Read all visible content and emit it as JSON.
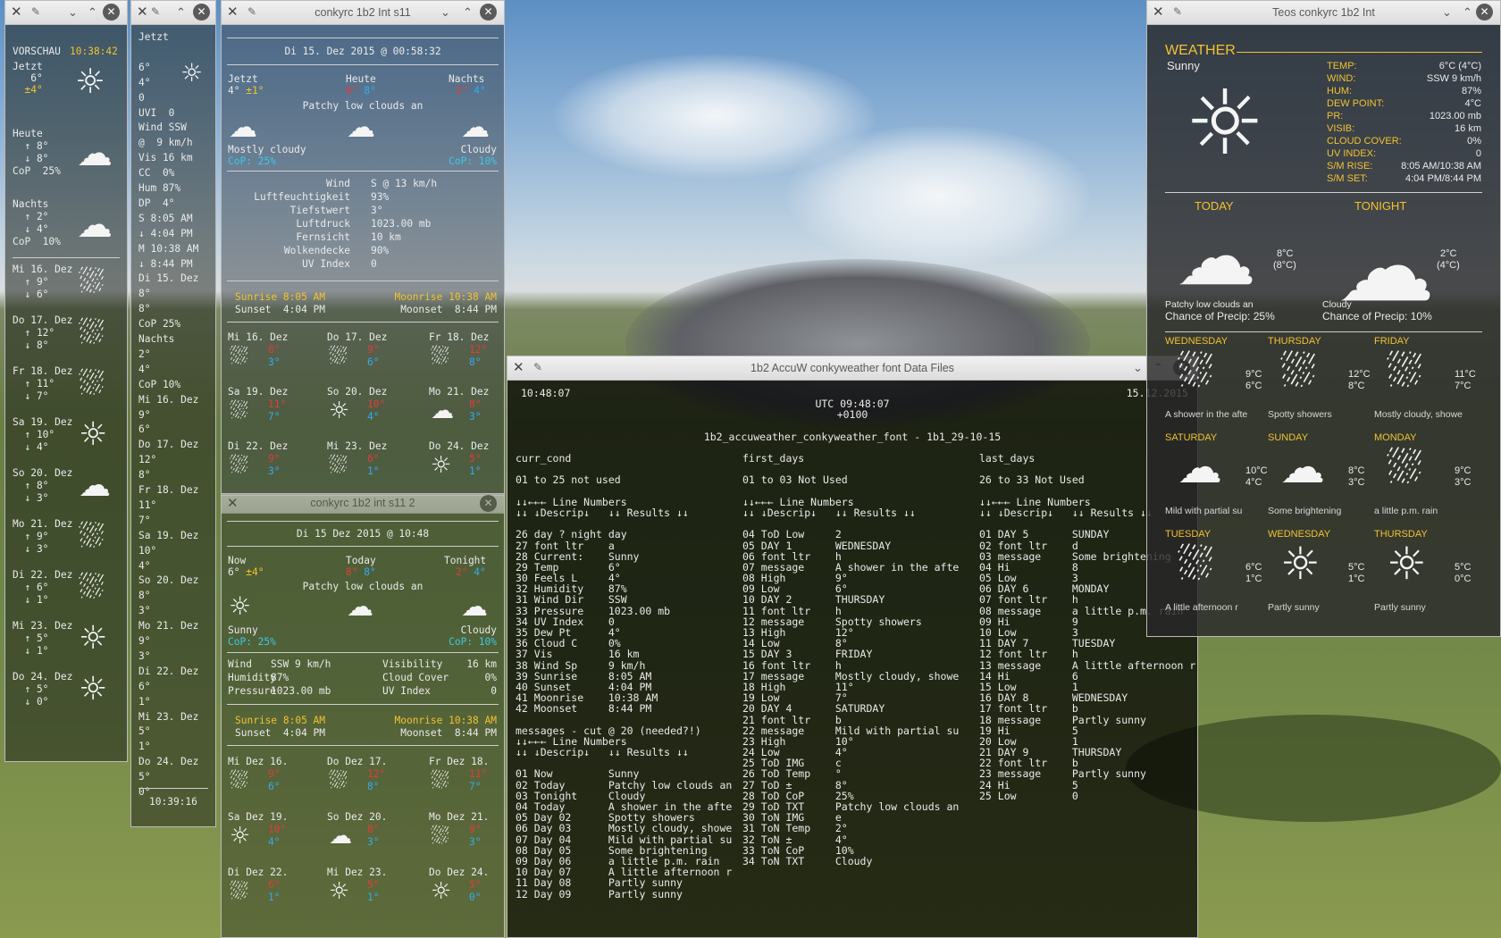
{
  "win_a": {
    "hdr": [
      "VORSCHAU",
      "10:38:42"
    ],
    "now": [
      "Jetzt",
      "   6°",
      "  ±4°"
    ],
    "today": [
      "Heute",
      "  ↑ 8°",
      "  ↓ 8°",
      "CoP  25%"
    ],
    "night": [
      "Nachts",
      "  ↑ 2°",
      "  ↓ 4°",
      "CoP  10%"
    ],
    "days": [
      {
        "n": "Mi 16. Dez",
        "h": "  ↑ 9°",
        "l": "  ↓ 6°"
      },
      {
        "n": "Do 17. Dez",
        "h": "  ↑ 12°",
        "l": "  ↓ 8°"
      },
      {
        "n": "Fr 18. Dez",
        "h": "  ↑ 11°",
        "l": "  ↓ 7°"
      },
      {
        "n": "Sa 19. Dez",
        "h": "  ↑ 10°",
        "l": "  ↓ 4°"
      },
      {
        "n": "So 20. Dez",
        "h": "  ↑ 8°",
        "l": "  ↓ 3°"
      },
      {
        "n": "Mo 21. Dez",
        "h": "  ↑ 9°",
        "l": "  ↓ 3°"
      },
      {
        "n": "Di 22. Dez",
        "h": "  ↑ 6°",
        "l": "  ↓ 1°"
      },
      {
        "n": "Mi 23. Dez",
        "h": "  ↑ 5°",
        "l": "  ↓ 1°"
      },
      {
        "n": "Do 24. Dez",
        "h": "  ↑ 5°",
        "l": "  ↓ 0°"
      }
    ]
  },
  "win_b": {
    "lines": [
      "Jetzt",
      "",
      "6°",
      "4°",
      "0",
      "UVI  0",
      "Wind SSW",
      "@  9 km/h",
      "Vis 16 km",
      "CC  0%",
      "Hum 87%",
      "DP  4°",
      "S 8:05 AM",
      "↓ 4:04 PM",
      "M 10:38 AM",
      "↓ 8:44 PM",
      "Di 15. Dez",
      "8°",
      "8°",
      "CoP 25%",
      "Nachts",
      "2°",
      "4°",
      "CoP 10%",
      "Mi 16. Dez",
      "9°",
      "6°",
      "Do 17. Dez",
      "12°",
      "8°",
      "Fr 18. Dez",
      "11°",
      "7°",
      "Sa 19. Dez",
      "10°",
      "4°",
      "So 20. Dez",
      "8°",
      "3°",
      "Mo 21. Dez",
      "9°",
      "3°",
      "Di 22. Dez",
      "6°",
      "1°",
      "Mi 23. Dez",
      "5°",
      "1°",
      "Do 24. Dez",
      "5°",
      "0°"
    ],
    "clock": "10:39:16"
  },
  "win_c": {
    "title": "conkyrc 1b2 Int s11",
    "date": "Di 15. Dez 2015 @ 00:58:32",
    "cols": [
      "Jetzt",
      "Heute",
      "Nachts"
    ],
    "now_t": "4°",
    "now_f": "±1°",
    "today_h": "8°",
    "today_l": "8°",
    "night_h": "3°",
    "night_l": "4°",
    "desc": "Patchy low clouds an",
    "left_desc": "Mostly cloudy",
    "left_cop": "CoP: 25%",
    "right_desc": "Cloudy",
    "right_cop": "CoP: 10%",
    "details": [
      [
        "Wind",
        "S @ 13 km/h"
      ],
      [
        "Luftfeuchtigkeit",
        "93%"
      ],
      [
        "Tiefstwert",
        "3°"
      ],
      [
        "Luftdruck",
        "1023.00 mb"
      ],
      [
        "Fernsicht",
        "10 km"
      ],
      [
        "Wolkendecke",
        "90%"
      ],
      [
        "UV Index",
        "0"
      ]
    ],
    "sunrise": "Sunrise 8:05 AM",
    "sunset": "Sunset  4:04 PM",
    "moonrise": "Moonrise 10:38 AM",
    "moonset": "Moonset  8:44 PM",
    "days": [
      {
        "n": "Mi 16. Dez",
        "h": "8°",
        "l": "3°"
      },
      {
        "n": "Do 17. Dez",
        "h": "9°",
        "l": "6°"
      },
      {
        "n": "Fr 18. Dez",
        "h": "12°",
        "l": "8°"
      },
      {
        "n": "Sa 19. Dez",
        "h": "11°",
        "l": "7°"
      },
      {
        "n": "So 20. Dez",
        "h": "10°",
        "l": "4°"
      },
      {
        "n": "Mo 21. Dez",
        "h": "8°",
        "l": "3°"
      },
      {
        "n": "Di 22. Dez",
        "h": "9°",
        "l": "3°"
      },
      {
        "n": "Mi 23. Dez",
        "h": "6°",
        "l": "1°"
      },
      {
        "n": "Do 24. Dez",
        "h": "5°",
        "l": "1°"
      }
    ]
  },
  "win_d": {
    "title": "conkyrc 1b2 int s11 2",
    "date": "Di 15 Dez 2015 @ 10:48",
    "cols": [
      "Now",
      "Today",
      "Tonight"
    ],
    "now_t": "6°",
    "now_f": "±4°",
    "today_h": "8°",
    "today_l": "8°",
    "night_h": "2°",
    "night_l": "4°",
    "desc": "Patchy low clouds an",
    "left_desc": "Sunny",
    "left_cop": "CoP: 25%",
    "right_desc": "Cloudy",
    "right_cop": "CoP: 10%",
    "details": [
      [
        "Wind",
        "SSW 9 km/h",
        "Visibility",
        "16 km"
      ],
      [
        "Humidity",
        "87%",
        "Cloud Cover",
        "0%"
      ],
      [
        "Pressure",
        "1023.00 mb",
        "UV Index",
        "0"
      ]
    ],
    "sunrise": "Sunrise 8:05 AM",
    "sunset": "Sunset  4:04 PM",
    "moonrise": "Moonrise 10:38 AM",
    "moonset": "Moonset  8:44 PM",
    "days": [
      {
        "n": "Mi Dez 16.",
        "h": "9°",
        "l": "6°"
      },
      {
        "n": "Do Dez 17.",
        "h": "12°",
        "l": "8°"
      },
      {
        "n": "Fr Dez 18.",
        "h": "11°",
        "l": "7°"
      },
      {
        "n": "Sa Dez 19.",
        "h": "10°",
        "l": "4°"
      },
      {
        "n": "So Dez 20.",
        "h": "8°",
        "l": "3°"
      },
      {
        "n": "Mo Dez 21.",
        "h": "9°",
        "l": "3°"
      },
      {
        "n": "Di Dez 22.",
        "h": "6°",
        "l": "1°"
      },
      {
        "n": "Mi Dez 23.",
        "h": "5°",
        "l": "1°"
      },
      {
        "n": "Do Dez 24.",
        "h": "5°",
        "l": "0°"
      }
    ]
  },
  "win_e": {
    "title": "1b2 AccuW conkyweather font Data Files",
    "time": "10:48:07",
    "date": "15.12.2015",
    "utc": "UTC 09:48:07",
    "tz": "+0100",
    "file": "1b2_accuweather_conkyweather_font - 1b1_29-10-15",
    "col1": "curr_cond\n\n01 to 25 not used\n\n↓↓←←← Line Numbers\n↓↓ ↓Descrip↓   ↓↓ Results ↓↓\n\n26 day ? night day\n27 font ltr    a\n28 Current:    Sunny\n29 Temp        6°\n30 Feels L     4°\n32 Humidity    87%\n31 Wind Dir    SSW\n33 Pressure    1023.00 mb\n34 UV Index    0\n35 Dew Pt      4°\n36 Cloud C     0%\n37 Vis         16 km\n38 Wind Sp     9 km/h\n39 Sunrise     8:05 AM\n40 Sunset      4:04 PM\n41 Moonrise    10:38 AM\n42 Moonset     8:44 PM\n\nmessages - cut @ 20 (needed?!)\n↓↓←←← Line Numbers\n↓↓ ↓Descrip↓   ↓↓ Results ↓↓\n\n01 Now         Sunny\n02 Today       Patchy low clouds an\n03 Tonight     Cloudy\n04 Today       A shower in the afte\n05 Day 02      Spotty showers\n06 Day 03      Mostly cloudy, showe\n07 Day 04      Mild with partial su\n08 Day 05      Some brightening\n09 Day 06      a little p.m. rain\n10 Day 07      A little afternoon r\n11 Day 08      Partly sunny\n12 Day 09      Partly sunny",
    "col2": "first_days\n\n01 to 03 Not Used\n\n↓↓←←← Line Numbers\n↓↓ ↓Descrip↓   ↓↓ Results ↓↓\n\n04 ToD Low     2\n05 DAY 1       WEDNESDAY\n06 font ltr    h\n07 message     A shower in the afte\n08 High        9°\n09 Low         6°\n10 DAY 2       THURSDAY\n11 font ltr    h\n12 message     Spotty showers\n13 High        12°\n14 Low         8°\n15 DAY 3       FRIDAY\n16 font ltr    h\n17 message     Mostly cloudy, showe\n18 High        11°\n19 Low         7°\n20 DAY 4       SATURDAY\n21 font ltr    b\n22 message     Mild with partial su\n23 High        10°\n24 Low         4°\n25 ToD IMG     c\n26 ToD Temp    °\n27 ToD ±       8°\n28 ToD CoP     25%\n29 ToD TXT     Patchy low clouds an\n30 ToN IMG     e\n31 ToN Temp    2°\n32 ToN ±       4°\n33 ToN CoP     10%\n34 ToN TXT     Cloudy",
    "col3": "last_days\n\n26 to 33 Not Used\n\n↓↓←←← Line Numbers\n↓↓ ↓Descrip↓   ↓↓ Results ↓↓\n\n01 DAY 5       SUNDAY\n02 font ltr    d\n03 message     Some brightening\n04 Hi          8\n05 Low         3\n06 DAY 6       MONDAY\n07 font ltr    h\n08 message     a little p.m. rain\n09 Hi          9\n10 Low         3\n11 DAY 7       TUESDAY\n12 font ltr    h\n13 message     A little afternoon r\n14 Hi          6\n15 Low         1\n16 DAY 8       WEDNESDAY\n17 font ltr    b\n18 message     Partly sunny\n19 Hi          5\n20 Low         1\n21 DAY 9       THURSDAY\n22 font ltr    b\n23 message     Partly sunny\n24 Hi          5\n25 Low         0"
  },
  "win_f": {
    "title": "Teos conkyrc 1b2 Int",
    "heading": "WEATHER",
    "cond": "Sunny",
    "stats": [
      [
        "TEMP:",
        "6°C (4°C)"
      ],
      [
        "WIND:",
        "SSW 9 km/h"
      ],
      [
        "HUM:",
        "87%"
      ],
      [
        "DEW POINT:",
        "4°C"
      ],
      [
        "PR:",
        "1023.00 mb"
      ],
      [
        "VISIB:",
        "16 km"
      ],
      [
        "CLOUD COVER:",
        "0%"
      ],
      [
        "UV INDEX:",
        "0"
      ],
      [
        "S/M RISE:",
        "8:05 AM/10:38 AM"
      ],
      [
        "S/M SET:",
        "4:04 PM/8:44 PM"
      ]
    ],
    "today": {
      "label": "TODAY",
      "temp": "8°C",
      "feel": "(8°C)",
      "desc": "Patchy low clouds an",
      "cop": "Chance of Precip: 25%"
    },
    "tonight": {
      "label": "TONIGHT",
      "temp": "2°C",
      "feel": "(4°C)",
      "desc": "Cloudy",
      "cop": "Chance of Precip: 10%"
    },
    "days": [
      {
        "n": "WEDNESDAY",
        "h": "9°C",
        "l": "6°C",
        "d": "A shower in the afte"
      },
      {
        "n": "THURSDAY",
        "h": "12°C",
        "l": "8°C",
        "d": "Spotty showers"
      },
      {
        "n": "FRIDAY",
        "h": "11°C",
        "l": "7°C",
        "d": "Mostly cloudy, showe"
      },
      {
        "n": "SATURDAY",
        "h": "10°C",
        "l": "4°C",
        "d": "Mild with partial su"
      },
      {
        "n": "SUNDAY",
        "h": "8°C",
        "l": "3°C",
        "d": "Some brightening"
      },
      {
        "n": "MONDAY",
        "h": "9°C",
        "l": "3°C",
        "d": "a little p.m. rain"
      },
      {
        "n": "TUESDAY",
        "h": "6°C",
        "l": "1°C",
        "d": "A little afternoon r"
      },
      {
        "n": "WEDNESDAY",
        "h": "5°C",
        "l": "1°C",
        "d": "Partly sunny"
      },
      {
        "n": "THURSDAY",
        "h": "5°C",
        "l": "0°C",
        "d": "Partly sunny"
      }
    ]
  },
  "icons": {
    "sun": "☼",
    "cloud": "☁",
    "rain": "⛆",
    "pin": "📌",
    "close": "✕",
    "collapse": "⌄",
    "expand": "⌃"
  },
  "colors": {
    "accent": "#f2c230",
    "high": "#e23b3b",
    "low": "#33aaf2",
    "panel": "#2e2e2e"
  }
}
